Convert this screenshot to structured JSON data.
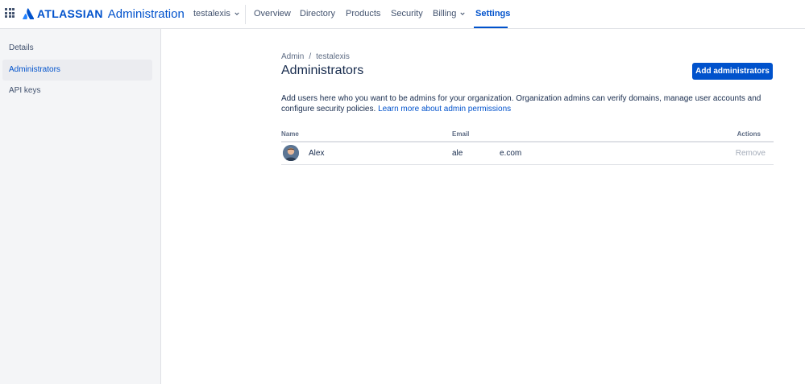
{
  "header": {
    "app_switcher_icon": "grid-icon",
    "brand_word": "ATLASSIAN",
    "product": "Administration",
    "org": "testalexis",
    "nav": [
      {
        "label": "Overview"
      },
      {
        "label": "Directory"
      },
      {
        "label": "Products"
      },
      {
        "label": "Security"
      },
      {
        "label": "Billing"
      },
      {
        "label": "Settings"
      }
    ],
    "active_tab": "Settings",
    "brand_color": "#0052CC"
  },
  "sidebar": {
    "items": [
      {
        "label": "Details"
      },
      {
        "label": "Administrators"
      },
      {
        "label": "API keys"
      }
    ],
    "active_item": "Administrators"
  },
  "main": {
    "breadcrumb": [
      "Admin",
      "testalexis"
    ],
    "title": "Administrators",
    "add_button": "Add administrators",
    "description": "Add users here who you want to be admins for your organization. Organization admins can verify domains, manage user accounts and configure security policies.",
    "learn_more": "Learn more about admin permissions",
    "table": {
      "headers": {
        "name": "Name",
        "email": "Email",
        "actions": "Actions"
      },
      "rows": [
        {
          "name": "Alex",
          "email_start": "ale",
          "email_end": "e.com",
          "action": "Remove"
        }
      ]
    }
  }
}
